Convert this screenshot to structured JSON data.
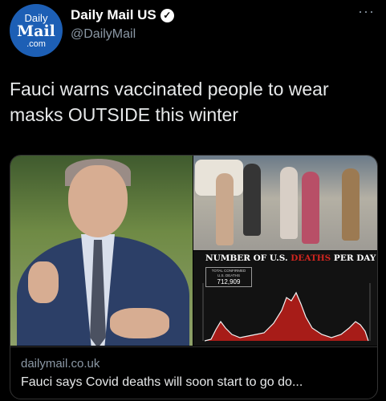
{
  "header": {
    "avatar_line1": "Daily",
    "avatar_line2": "Mail",
    "avatar_line3": ".com",
    "display_name": "Daily Mail US",
    "verified_icon": "✓",
    "handle": "@DailyMail",
    "more_icon": "···"
  },
  "tweet": {
    "text": "Fauci warns vaccinated people to wear masks OUTSIDE this winter"
  },
  "card": {
    "chart_title_part1": "NUMBER OF U.S. ",
    "chart_title_part2": "DEATHS",
    "chart_title_part3": " PER DAY",
    "deaths_label": "TOTAL CONFIRMED U.S. DEATHS",
    "deaths_value": "712,909",
    "domain": "dailymail.co.uk",
    "title": "Fauci says Covid deaths will soon start to go do..."
  },
  "colors": {
    "avatar_blue": "#1d5fb5",
    "chart_red": "#d0261f",
    "muted_text": "#8b98a5"
  }
}
